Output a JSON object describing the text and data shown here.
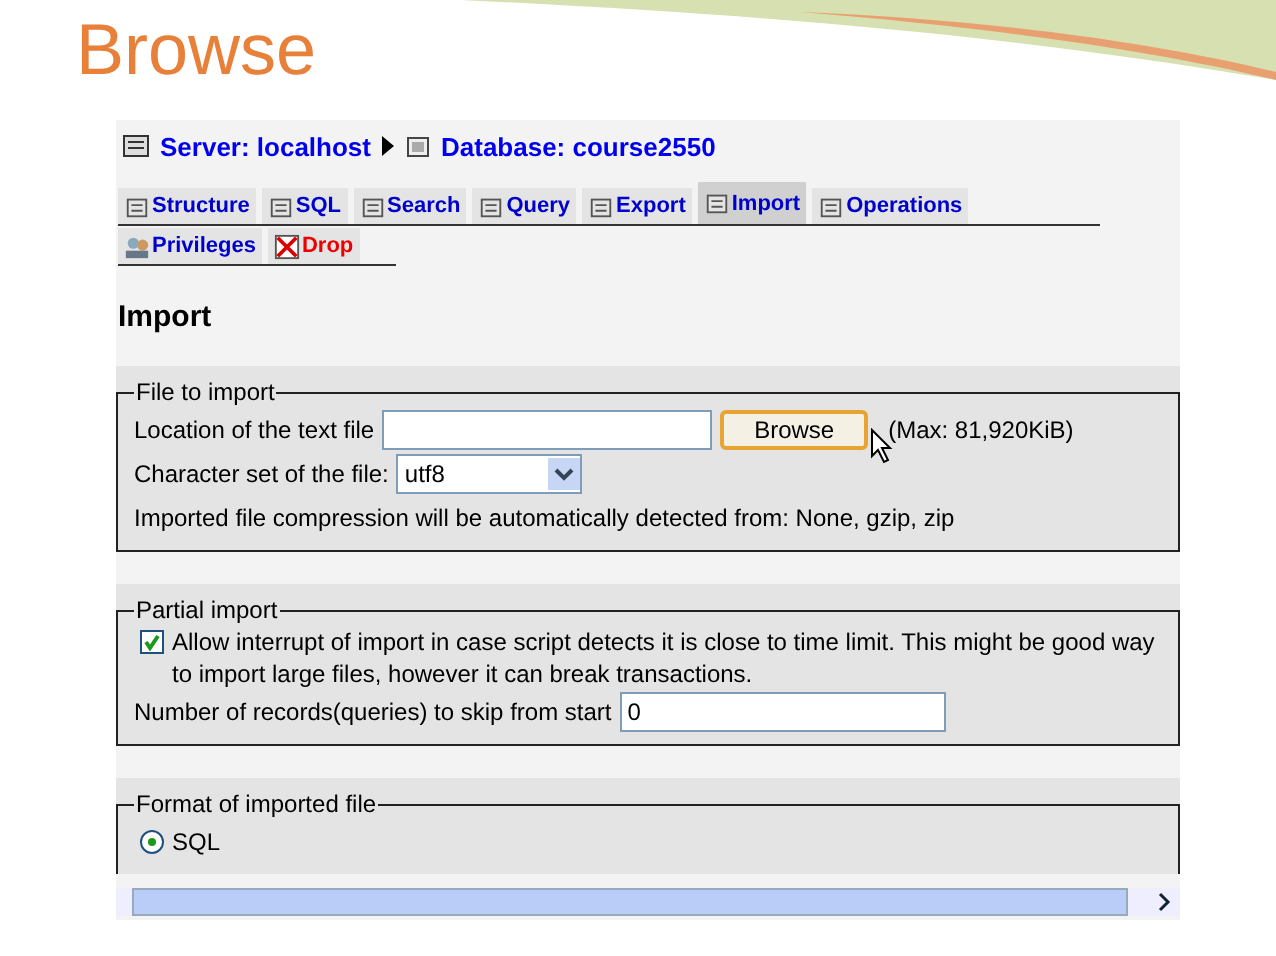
{
  "slide_title": "Browse",
  "breadcrumb": {
    "server": "Server: localhost",
    "database": "Database: course2550"
  },
  "tabs": [
    {
      "label": "Structure",
      "selected": false,
      "kind": "normal"
    },
    {
      "label": "SQL",
      "selected": false,
      "kind": "normal"
    },
    {
      "label": "Search",
      "selected": false,
      "kind": "normal"
    },
    {
      "label": "Query",
      "selected": false,
      "kind": "normal"
    },
    {
      "label": "Export",
      "selected": false,
      "kind": "normal"
    },
    {
      "label": "Import",
      "selected": true,
      "kind": "normal"
    },
    {
      "label": "Operations",
      "selected": false,
      "kind": "normal"
    },
    {
      "label": "Privileges",
      "selected": false,
      "kind": "normal"
    },
    {
      "label": "Drop",
      "selected": false,
      "kind": "danger"
    }
  ],
  "heading": "Import",
  "file_to_import": {
    "legend": "File to import",
    "location_label": "Location of the text file",
    "browse_button": "Browse",
    "max_note": "(Max: 81,920KiB)",
    "charset_label": "Character set of the file:",
    "charset_value": "utf8",
    "compression_note": "Imported file compression will be automatically detected from: None, gzip, zip"
  },
  "partial_import": {
    "legend": "Partial import",
    "allow_interrupt": {
      "label": "Allow interrupt of import in case script detects it is close to time limit. This might be good way to import large files, however it can break transactions.",
      "checked": true
    },
    "skip_label": "Number of records(queries) to skip from start",
    "skip_value": "0"
  },
  "format": {
    "legend": "Format of imported file",
    "options": [
      {
        "label": "SQL",
        "selected": true
      }
    ]
  }
}
